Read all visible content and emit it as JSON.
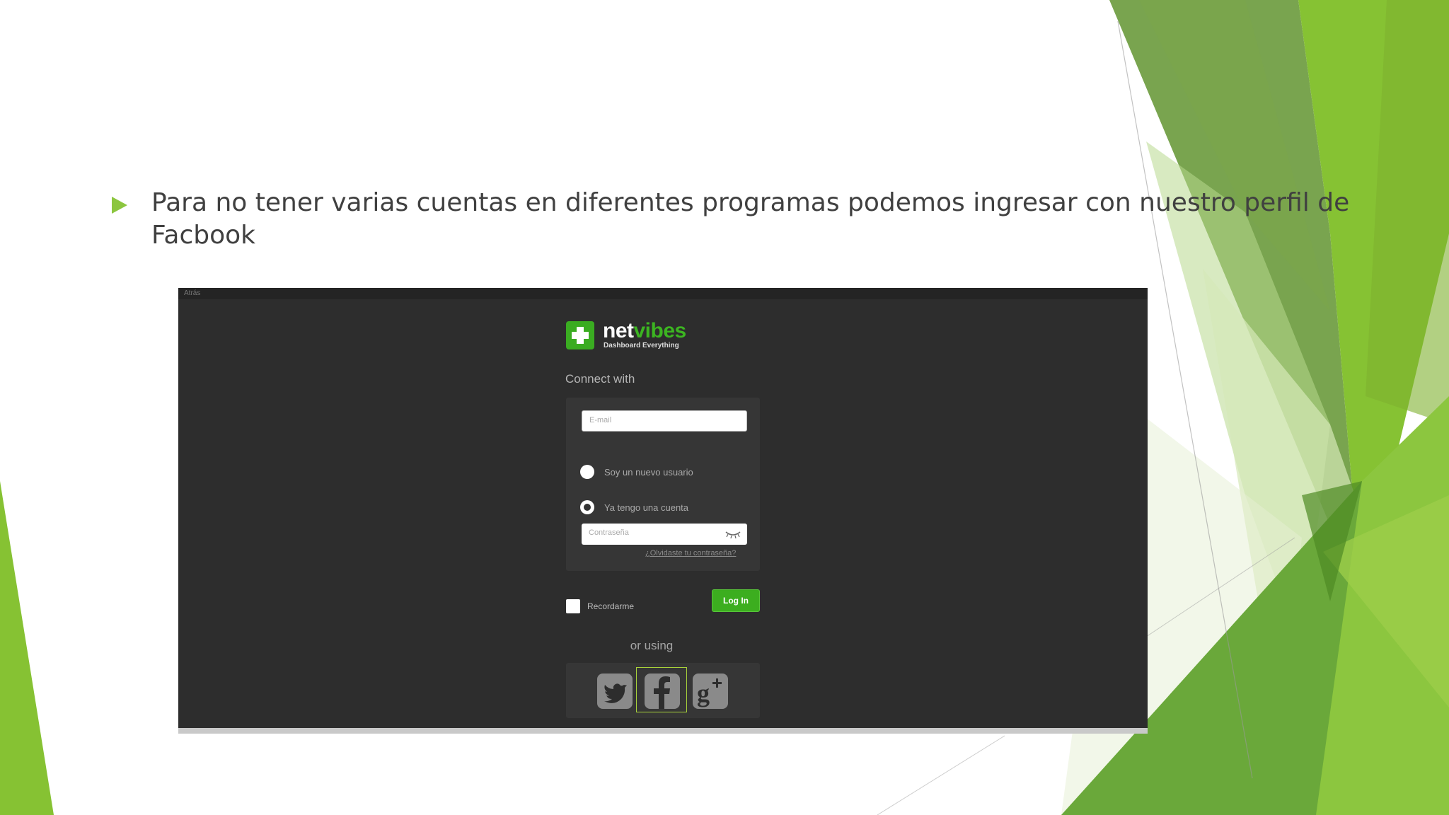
{
  "slide": {
    "bullet_text": "Para no tener varias cuentas en diferentes programas podemos ingresar con nuestro perfil de Facbook",
    "accent_color": "#8cc63f"
  },
  "screenshot": {
    "back_link": "Atrás",
    "logo": {
      "word_part1": "net",
      "word_part2": "vibes",
      "tagline": "Dashboard Everything",
      "brand_color": "#3cb521"
    },
    "connect_with": "Connect with",
    "email_placeholder": "E-mail",
    "radio_new_user": "Soy un nuevo usuario",
    "radio_existing": "Ya tengo una cuenta",
    "selected_radio": "Ya tengo una cuenta",
    "password_placeholder": "Contraseña",
    "forgot_password": "¿Olvidaste tu contraseña?",
    "remember_me": "Recordarme",
    "login_button": "Log In",
    "or_using": "or using",
    "social_icons": [
      "twitter-icon",
      "facebook-icon",
      "google-plus-icon"
    ],
    "highlighted_icon": "facebook-icon"
  }
}
